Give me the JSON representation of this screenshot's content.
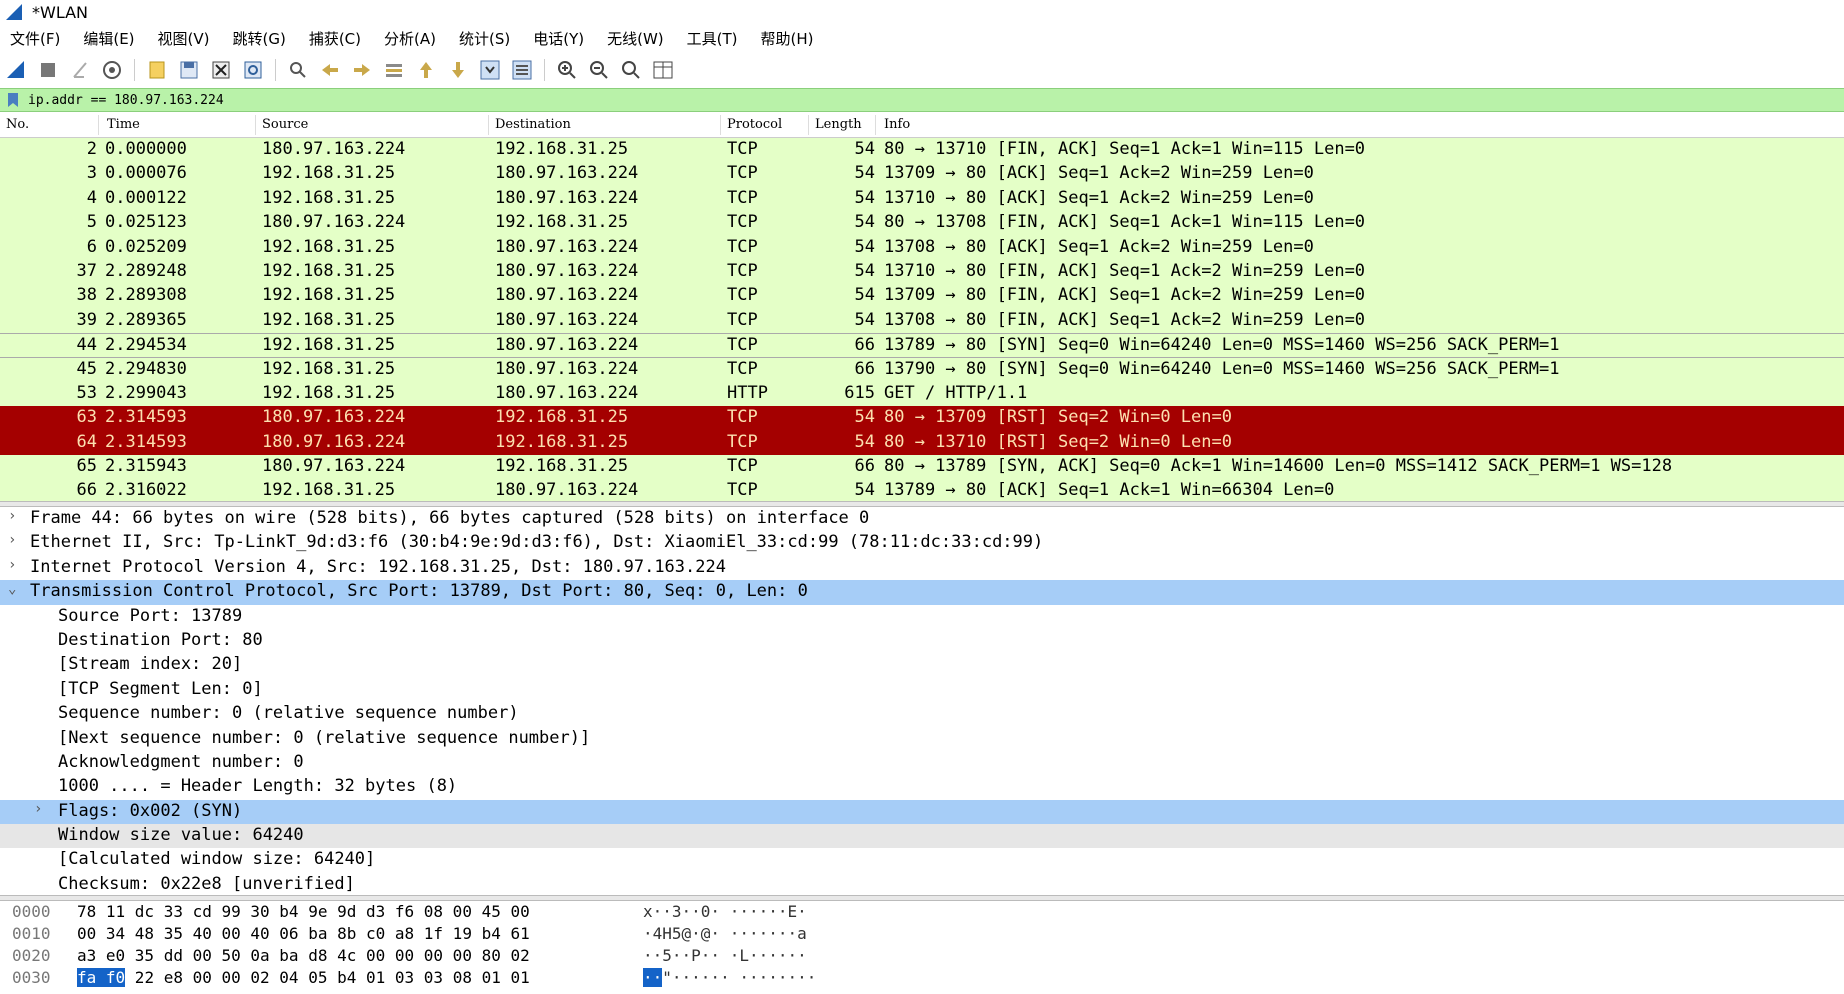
{
  "window": {
    "title": "*WLAN"
  },
  "menu": [
    "文件(F)",
    "编辑(E)",
    "视图(V)",
    "跳转(G)",
    "捕获(C)",
    "分析(A)",
    "统计(S)",
    "电话(Y)",
    "无线(W)",
    "工具(T)",
    "帮助(H)"
  ],
  "toolbar_icons": [
    "shark-fin-start-icon",
    "stop-icon",
    "restart-icon",
    "options-gear-icon",
    "open-file-icon",
    "save-file-icon",
    "close-file-icon",
    "reload-icon",
    "find-icon",
    "go-back-icon",
    "go-forward-icon",
    "go-to-packet-icon",
    "first-packet-icon",
    "last-packet-icon",
    "autoscroll-icon",
    "colorize-icon",
    "zoom-in-icon",
    "zoom-out-icon",
    "zoom-normal-icon",
    "resize-columns-icon"
  ],
  "filter": {
    "value": "ip.addr == 180.97.163.224"
  },
  "columns": [
    "No.",
    "Time",
    "Source",
    "Destination",
    "Protocol",
    "Length",
    "Info"
  ],
  "packets": [
    {
      "no": "2",
      "time": "0.000000",
      "src": "180.97.163.224",
      "dst": "192.168.31.25",
      "proto": "TCP",
      "len": "54",
      "info": "80 → 13710 [FIN, ACK] Seq=1 Ack=1 Win=115 Len=0",
      "style": "g"
    },
    {
      "no": "3",
      "time": "0.000076",
      "src": "192.168.31.25",
      "dst": "180.97.163.224",
      "proto": "TCP",
      "len": "54",
      "info": "13709 → 80 [ACK] Seq=1 Ack=2 Win=259 Len=0",
      "style": "g"
    },
    {
      "no": "4",
      "time": "0.000122",
      "src": "192.168.31.25",
      "dst": "180.97.163.224",
      "proto": "TCP",
      "len": "54",
      "info": "13710 → 80 [ACK] Seq=1 Ack=2 Win=259 Len=0",
      "style": "g"
    },
    {
      "no": "5",
      "time": "0.025123",
      "src": "180.97.163.224",
      "dst": "192.168.31.25",
      "proto": "TCP",
      "len": "54",
      "info": "80 → 13708 [FIN, ACK] Seq=1 Ack=1 Win=115 Len=0",
      "style": "g"
    },
    {
      "no": "6",
      "time": "0.025209",
      "src": "192.168.31.25",
      "dst": "180.97.163.224",
      "proto": "TCP",
      "len": "54",
      "info": "13708 → 80 [ACK] Seq=1 Ack=2 Win=259 Len=0",
      "style": "g"
    },
    {
      "no": "37",
      "time": "2.289248",
      "src": "192.168.31.25",
      "dst": "180.97.163.224",
      "proto": "TCP",
      "len": "54",
      "info": "13710 → 80 [FIN, ACK] Seq=1 Ack=2 Win=259 Len=0",
      "style": "g"
    },
    {
      "no": "38",
      "time": "2.289308",
      "src": "192.168.31.25",
      "dst": "180.97.163.224",
      "proto": "TCP",
      "len": "54",
      "info": "13709 → 80 [FIN, ACK] Seq=1 Ack=2 Win=259 Len=0",
      "style": "g"
    },
    {
      "no": "39",
      "time": "2.289365",
      "src": "192.168.31.25",
      "dst": "180.97.163.224",
      "proto": "TCP",
      "len": "54",
      "info": "13708 → 80 [FIN, ACK] Seq=1 Ack=2 Win=259 Len=0",
      "style": "g"
    },
    {
      "no": "44",
      "time": "2.294534",
      "src": "192.168.31.25",
      "dst": "180.97.163.224",
      "proto": "TCP",
      "len": "66",
      "info": "13789 → 80 [SYN] Seq=0 Win=64240 Len=0 MSS=1460 WS=256 SACK_PERM=1",
      "style": "gs"
    },
    {
      "no": "45",
      "time": "2.294830",
      "src": "192.168.31.25",
      "dst": "180.97.163.224",
      "proto": "TCP",
      "len": "66",
      "info": "13790 → 80 [SYN] Seq=0 Win=64240 Len=0 MSS=1460 WS=256 SACK_PERM=1",
      "style": "g"
    },
    {
      "no": "53",
      "time": "2.299043",
      "src": "192.168.31.25",
      "dst": "180.97.163.224",
      "proto": "HTTP",
      "len": "615",
      "info": "GET / HTTP/1.1",
      "style": "g"
    },
    {
      "no": "63",
      "time": "2.314593",
      "src": "180.97.163.224",
      "dst": "192.168.31.25",
      "proto": "TCP",
      "len": "54",
      "info": "80 → 13709 [RST] Seq=2 Win=0 Len=0",
      "style": "r"
    },
    {
      "no": "64",
      "time": "2.314593",
      "src": "180.97.163.224",
      "dst": "192.168.31.25",
      "proto": "TCP",
      "len": "54",
      "info": "80 → 13710 [RST] Seq=2 Win=0 Len=0",
      "style": "r"
    },
    {
      "no": "65",
      "time": "2.315943",
      "src": "180.97.163.224",
      "dst": "192.168.31.25",
      "proto": "TCP",
      "len": "66",
      "info": "80 → 13789 [SYN, ACK] Seq=0 Ack=1 Win=14600 Len=0 MSS=1412 SACK_PERM=1 WS=128",
      "style": "g"
    },
    {
      "no": "66",
      "time": "2.316022",
      "src": "192.168.31.25",
      "dst": "180.97.163.224",
      "proto": "TCP",
      "len": "54",
      "info": "13789 → 80 [ACK] Seq=1 Ack=1 Win=66304 Len=0",
      "style": "g"
    }
  ],
  "details": [
    {
      "text": "Frame 44: 66 bytes on wire (528 bits), 66 bytes captured (528 bits) on interface 0",
      "indent": 0,
      "arrow": "›",
      "style": ""
    },
    {
      "text": "Ethernet II, Src: Tp-LinkT_9d:d3:f6 (30:b4:9e:9d:d3:f6), Dst: XiaomiEl_33:cd:99 (78:11:dc:33:cd:99)",
      "indent": 0,
      "arrow": "›",
      "style": ""
    },
    {
      "text": "Internet Protocol Version 4, Src: 192.168.31.25, Dst: 180.97.163.224",
      "indent": 0,
      "arrow": "›",
      "style": ""
    },
    {
      "text": "Transmission Control Protocol, Src Port: 13789, Dst Port: 80, Seq: 0, Len: 0",
      "indent": 0,
      "arrow": "⌄",
      "style": "sel"
    },
    {
      "text": "Source Port: 13789",
      "indent": 1,
      "arrow": "",
      "style": ""
    },
    {
      "text": "Destination Port: 80",
      "indent": 1,
      "arrow": "",
      "style": ""
    },
    {
      "text": "[Stream index: 20]",
      "indent": 1,
      "arrow": "",
      "style": ""
    },
    {
      "text": "[TCP Segment Len: 0]",
      "indent": 1,
      "arrow": "",
      "style": ""
    },
    {
      "text": "Sequence number: 0    (relative sequence number)",
      "indent": 1,
      "arrow": "",
      "style": ""
    },
    {
      "text": "[Next sequence number: 0    (relative sequence number)]",
      "indent": 1,
      "arrow": "",
      "style": ""
    },
    {
      "text": "Acknowledgment number: 0",
      "indent": 1,
      "arrow": "",
      "style": ""
    },
    {
      "text": "1000 .... = Header Length: 32 bytes (8)",
      "indent": 1,
      "arrow": "",
      "style": ""
    },
    {
      "text": "Flags: 0x002 (SYN)",
      "indent": 1,
      "arrow": "›",
      "style": "sel2"
    },
    {
      "text": "Window size value: 64240",
      "indent": 1,
      "arrow": "",
      "style": "alt"
    },
    {
      "text": "[Calculated window size: 64240]",
      "indent": 1,
      "arrow": "",
      "style": ""
    },
    {
      "text": "Checksum: 0x22e8 [unverified]",
      "indent": 1,
      "arrow": "",
      "style": ""
    }
  ],
  "bytes": [
    {
      "off": "0000",
      "hex_pre": "",
      "hex_hl": "",
      "hex_post": "78 11 dc 33 cd 99 30 b4  9e 9d d3 f6 08 00 45 00",
      "asc_hl": "",
      "asc_post": "x··3··0· ······E·"
    },
    {
      "off": "0010",
      "hex_pre": "",
      "hex_hl": "",
      "hex_post": "00 34 48 35 40 00 40 06  ba 8b c0 a8 1f 19 b4 61",
      "asc_hl": "",
      "asc_post": "·4H5@·@· ·······a"
    },
    {
      "off": "0020",
      "hex_pre": "",
      "hex_hl": "",
      "hex_post": "a3 e0 35 dd 00 50 0a ba  d8 4c 00 00 00 00 80 02",
      "asc_hl": "",
      "asc_post": "··5··P·· ·L······"
    },
    {
      "off": "0030",
      "hex_pre": "",
      "hex_hl": "fa f0",
      "hex_post": " 22 e8 00 00 02 04  05 b4 01 03 03 08 01 01",
      "asc_hl": "··",
      "asc_post": "\"······ ········"
    }
  ]
}
